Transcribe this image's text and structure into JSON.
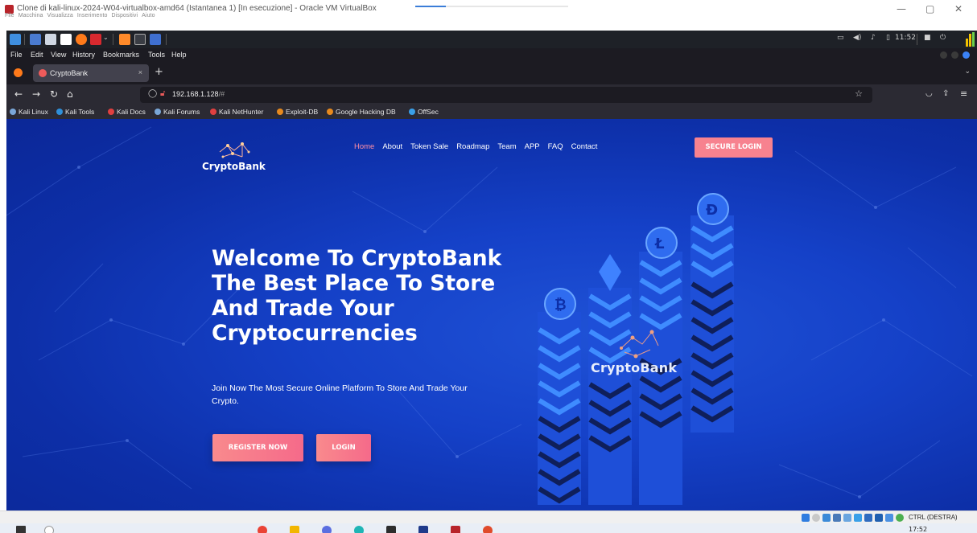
{
  "window": {
    "title": "Clone di kali-linux-2024-W04-virtualbox-amd64 (Istantanea 1) [In esecuzione] - Oracle VM VirtualBox",
    "menu": [
      "File",
      "Macchina",
      "Visualizza",
      "Inserimento",
      "Dispositivi",
      "Aiuto"
    ],
    "controls": {
      "minimize": "—",
      "maximize": "▢",
      "close": "✕"
    }
  },
  "kali_panel": {
    "clock": "11:52",
    "icons": [
      "kali-menu-icon",
      "desktop-icon",
      "file-manager-icon",
      "text-editor-icon",
      "firefox-icon",
      "terminal-icon",
      "burp-icon",
      "terminal2-icon",
      "workspace-icon"
    ]
  },
  "firefox": {
    "menubar": [
      "File",
      "Edit",
      "View",
      "History",
      "Bookmarks",
      "Tools",
      "Help"
    ],
    "tab": {
      "title": "CryptoBank",
      "close": "×"
    },
    "new_tab": "+",
    "url": {
      "host": "192.168.1.128",
      "path": "/#"
    },
    "bookmarks": [
      {
        "label": "Kali Linux",
        "color": "#7aa7d8"
      },
      {
        "label": "Kali Tools",
        "color": "#2f8fd8"
      },
      {
        "label": "Kali Docs",
        "color": "#e04040"
      },
      {
        "label": "Kali Forums",
        "color": "#7aa7d8"
      },
      {
        "label": "Kali NetHunter",
        "color": "#e04040"
      },
      {
        "label": "Exploit-DB",
        "color": "#e88a1e"
      },
      {
        "label": "Google Hacking DB",
        "color": "#e88a1e"
      },
      {
        "label": "OffSec",
        "color": "#3aa0e8"
      }
    ]
  },
  "site": {
    "logo_text": "CryptoBank",
    "nav": [
      "Home",
      "About",
      "Token Sale",
      "Roadmap",
      "Team",
      "APP",
      "FAQ",
      "Contact"
    ],
    "active_nav": "Home",
    "secure_login": "SECURE LOGIN",
    "hero_title": "Welcome To CryptoBank The Best Place To Store And Trade Your Cryptocurrencies",
    "hero_subtitle": "Join Now The Most Secure Online Platform To Store And Trade Your Crypto.",
    "register_button": "REGISTER NOW",
    "login_button": "LOGIN",
    "illustration_text": "CryptoBank",
    "accent_color": "#f7828f",
    "background_color": "#1541c8"
  },
  "vbox_status": {
    "host_key": "CTRL (DESTRA)"
  },
  "host_taskbar": {
    "clock": "17:52"
  }
}
